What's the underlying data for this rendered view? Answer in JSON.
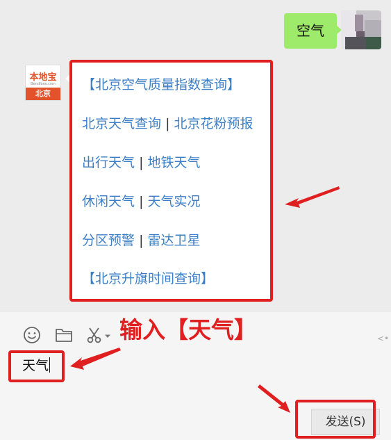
{
  "user_message": {
    "text": "空气"
  },
  "bot": {
    "avatar": {
      "logo_text": "本地宝",
      "site_text": "Bendibao.com",
      "city": "北京"
    },
    "lines": [
      {
        "items": [
          "【北京空气质量指数查询】"
        ]
      },
      {
        "items": [
          "北京天气查询",
          "北京花粉预报"
        ]
      },
      {
        "items": [
          "出行天气",
          "地铁天气"
        ]
      },
      {
        "items": [
          "休闲天气",
          "天气实况"
        ]
      },
      {
        "items": [
          "分区预警",
          "雷达卫星"
        ]
      },
      {
        "items": [
          "【北京升旗时间查询】"
        ]
      }
    ],
    "separator": "|"
  },
  "annotation": {
    "text": "输入【天气】"
  },
  "composer": {
    "input_value": "天气",
    "send_label": "发送(S)",
    "toolbar_icons": [
      "emoji-icon",
      "folder-icon",
      "scissors-icon",
      "chevron-down-icon"
    ]
  },
  "colors": {
    "bubble_user": "#9eea6a",
    "link": "#3d7fc6",
    "highlight": "#e02020",
    "brand": "#e2532c"
  }
}
